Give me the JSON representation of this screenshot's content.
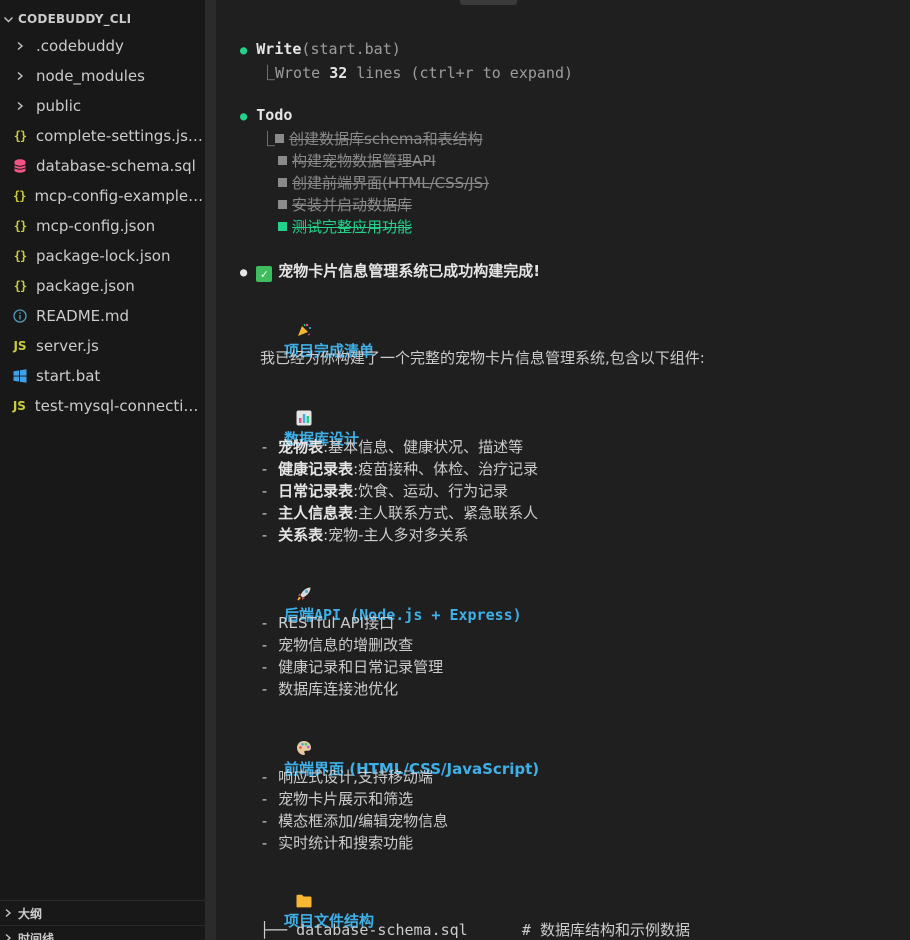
{
  "explorer": {
    "root_label": "CODEBUDDY_CLI",
    "items": [
      {
        "name": ".codebuddy",
        "icon": "chevron-right-icon",
        "type": "folder"
      },
      {
        "name": "node_modules",
        "icon": "chevron-right-icon",
        "type": "folder"
      },
      {
        "name": "public",
        "icon": "chevron-right-icon",
        "type": "folder"
      },
      {
        "name": "complete-settings.json",
        "icon": "json-icon",
        "type": "file"
      },
      {
        "name": "database-schema.sql",
        "icon": "database-icon",
        "type": "file"
      },
      {
        "name": "mcp-config-example.json",
        "icon": "json-icon",
        "type": "file"
      },
      {
        "name": "mcp-config.json",
        "icon": "json-icon",
        "type": "file"
      },
      {
        "name": "package-lock.json",
        "icon": "json-icon",
        "type": "file"
      },
      {
        "name": "package.json",
        "icon": "json-icon",
        "type": "file"
      },
      {
        "name": "README.md",
        "icon": "info-icon",
        "type": "file"
      },
      {
        "name": "server.js",
        "icon": "js-icon",
        "type": "file"
      },
      {
        "name": "start.bat",
        "icon": "windows-icon",
        "type": "file"
      },
      {
        "name": "test-mysql-connection.js",
        "icon": "js-icon",
        "type": "file"
      }
    ],
    "outline_label": "大纲",
    "timeline_label": "时间线"
  },
  "terminal": {
    "write_tool": "Write",
    "write_arg": "(start.bat)",
    "write_result_prefix": "⎿Wrote ",
    "write_result_count": "32",
    "write_result_suffix": " lines (ctrl+r to expand)",
    "todo_title": "Todo",
    "todo_items": [
      "创建数据库schema和表结构",
      "构建宠物数据管理API",
      "创建前端界面(HTML/CSS/JS)",
      "安装并启动数据库",
      "测试完整应用功能"
    ],
    "done_title": "宠物卡片信息管理系统已成功构建完成!",
    "section1_heading": "项目完成清单",
    "intro": "我已经为你构建了一个完整的宠物卡片信息管理系统,包含以下组件:",
    "db_heading": "数据库设计",
    "db_items": [
      {
        "bold": "宠物表",
        "text": ":基本信息、健康状况、描述等"
      },
      {
        "bold": "健康记录表",
        "text": ":疫苗接种、体检、治疗记录"
      },
      {
        "bold": "日常记录表",
        "text": ":饮食、运动、行为记录"
      },
      {
        "bold": "主人信息表",
        "text": ":主人联系方式、紧急联系人"
      },
      {
        "bold": "关系表",
        "text": ":宠物-主人多对多关系"
      }
    ],
    "api_heading": "后端API (Node.js + Express)",
    "api_items": [
      "RESTful API接口",
      "宠物信息的增删改查",
      "健康记录和日常记录管理",
      "数据库连接池优化"
    ],
    "fe_heading": "前端界面 (HTML/CSS/JavaScript)",
    "fe_items": [
      "响应式设计,支持移动端",
      "宠物卡片展示和筛选",
      "模态框添加/编辑宠物信息",
      "实时统计和搜索功能"
    ],
    "files_heading": "项目文件结构",
    "files_first": "├── database-schema.sql      # 数据库结构和示例数据"
  }
}
